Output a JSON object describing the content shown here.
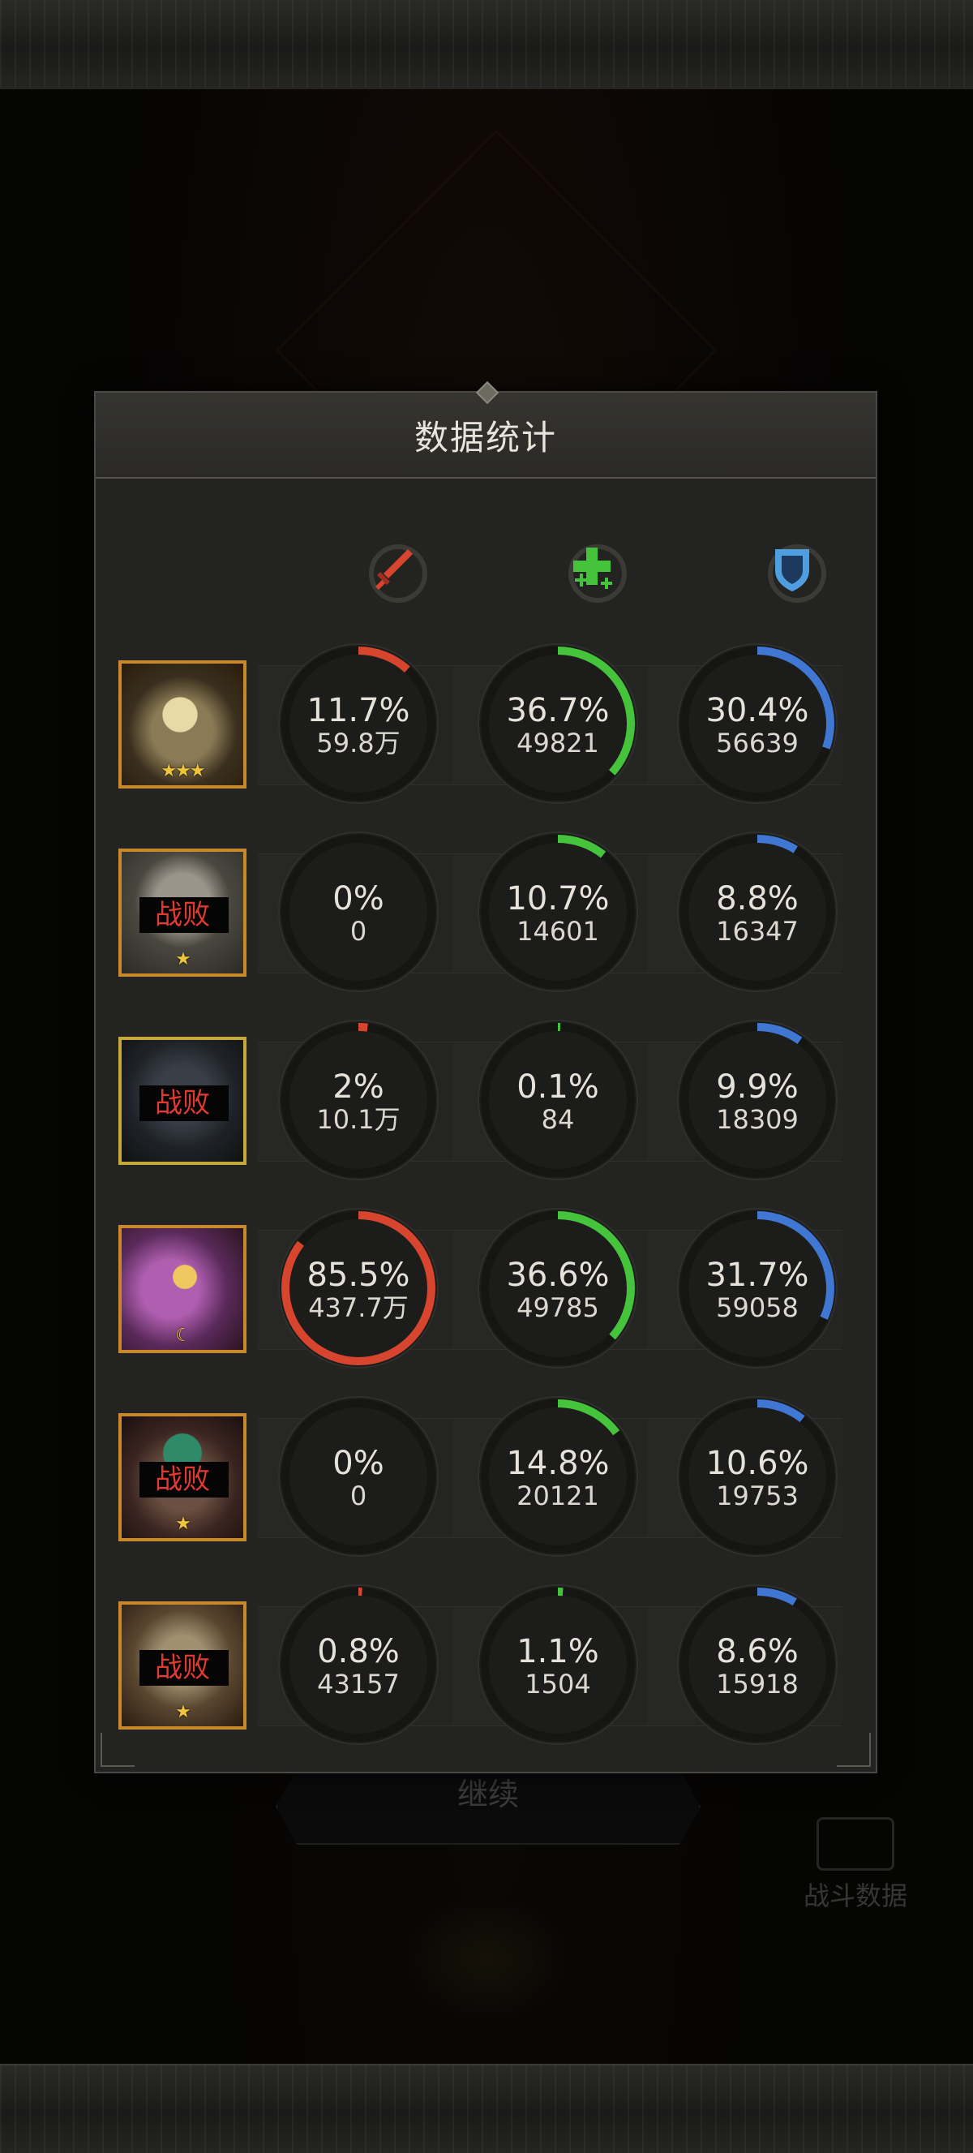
{
  "background": {
    "continue_label": "继续",
    "battle_data_label": "战斗数据"
  },
  "panel": {
    "title": "数据统计"
  },
  "stat_columns": [
    {
      "icon": "sword-icon",
      "color": "#d8452f"
    },
    {
      "icon": "heal-cross-icon",
      "color": "#45c33b"
    },
    {
      "icon": "shield-icon",
      "color": "#4f9fe0"
    }
  ],
  "colors": {
    "damage": "#d8452f",
    "heal": "#45c33b",
    "shield": "#3f77d2"
  },
  "heroes": [
    {
      "defeated": false,
      "defeat_label": "",
      "stars": "★★★",
      "damage": {
        "pct": "11.7%",
        "fraction": 0.117,
        "amount": "59.8万"
      },
      "heal": {
        "pct": "36.7%",
        "fraction": 0.367,
        "amount": "49821"
      },
      "shield": {
        "pct": "30.4%",
        "fraction": 0.304,
        "amount": "56639"
      }
    },
    {
      "defeated": true,
      "defeat_label": "战败",
      "stars": "★",
      "damage": {
        "pct": "0%",
        "fraction": 0,
        "amount": "0"
      },
      "heal": {
        "pct": "10.7%",
        "fraction": 0.107,
        "amount": "14601"
      },
      "shield": {
        "pct": "8.8%",
        "fraction": 0.088,
        "amount": "16347"
      }
    },
    {
      "defeated": true,
      "defeat_label": "战败",
      "stars": "",
      "damage": {
        "pct": "2%",
        "fraction": 0.02,
        "amount": "10.1万"
      },
      "heal": {
        "pct": "0.1%",
        "fraction": 0.001,
        "amount": "84"
      },
      "shield": {
        "pct": "9.9%",
        "fraction": 0.099,
        "amount": "18309"
      }
    },
    {
      "defeated": false,
      "defeat_label": "",
      "stars": "☾",
      "damage": {
        "pct": "85.5%",
        "fraction": 0.855,
        "amount": "437.7万"
      },
      "heal": {
        "pct": "36.6%",
        "fraction": 0.366,
        "amount": "49785"
      },
      "shield": {
        "pct": "31.7%",
        "fraction": 0.317,
        "amount": "59058"
      }
    },
    {
      "defeated": true,
      "defeat_label": "战败",
      "stars": "★",
      "damage": {
        "pct": "0%",
        "fraction": 0,
        "amount": "0"
      },
      "heal": {
        "pct": "14.8%",
        "fraction": 0.148,
        "amount": "20121"
      },
      "shield": {
        "pct": "10.6%",
        "fraction": 0.106,
        "amount": "19753"
      }
    },
    {
      "defeated": true,
      "defeat_label": "战败",
      "stars": "★",
      "damage": {
        "pct": "0.8%",
        "fraction": 0.008,
        "amount": "43157"
      },
      "heal": {
        "pct": "1.1%",
        "fraction": 0.011,
        "amount": "1504"
      },
      "shield": {
        "pct": "8.6%",
        "fraction": 0.086,
        "amount": "15918"
      }
    }
  ]
}
